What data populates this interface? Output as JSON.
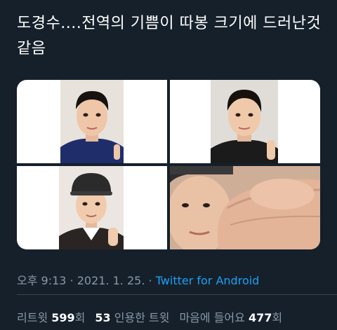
{
  "tweet": {
    "text": "도경수....전역의 기쁨이 따봉 크기에 드러난것같음",
    "images": [
      {
        "icon": "portrait-photo"
      },
      {
        "icon": "portrait-photo"
      },
      {
        "icon": "portrait-photo"
      },
      {
        "icon": "portrait-photo"
      }
    ],
    "timestamp": "오후 9:13 · 2021. 1. 25. · ",
    "source": "Twitter for Android"
  },
  "stats": {
    "retweets_label": "리트윗",
    "retweets_count": "599",
    "retweets_suffix": "회",
    "quotes_count": "53",
    "quotes_label": "인용한 트윗",
    "likes_label": "마음에 들어요",
    "likes_count": "477",
    "likes_suffix": "회"
  },
  "colors": {
    "background": "#15202b",
    "text": "#ffffff",
    "muted": "#8899a6",
    "link": "#1da1f2",
    "divider": "#38444d"
  }
}
